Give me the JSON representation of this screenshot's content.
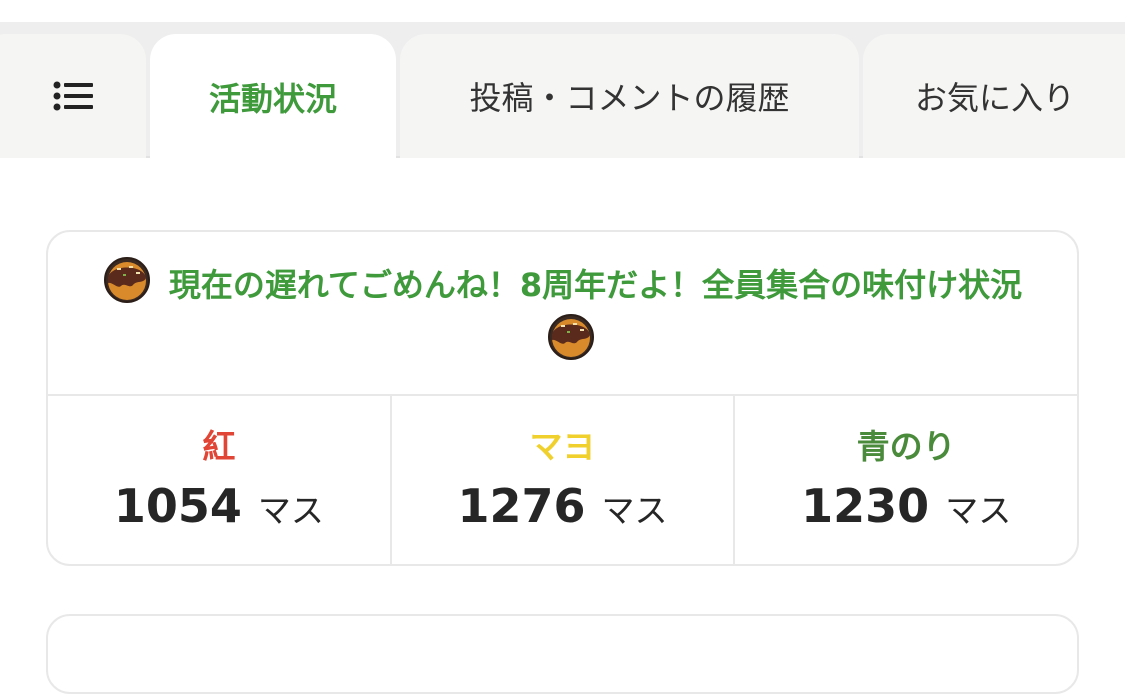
{
  "tabs": {
    "menu_icon": "list-icon",
    "activity": "活動状況",
    "posts": "投稿・コメントの履歴",
    "favorites": "お気に入り",
    "active_color": "#3f9a3c"
  },
  "event_card": {
    "title": "現在の遅れてごめんね！8周年だよ！全員集合の味付け状況",
    "decoration_icon": "takoyaki-icon",
    "teams": [
      {
        "name": "紅",
        "score": "1054",
        "unit": "マス",
        "color": "#e04535"
      },
      {
        "name": "マヨ",
        "score": "1276",
        "unit": "マス",
        "color": "#f0d02c"
      },
      {
        "name": "青のり",
        "score": "1230",
        "unit": "マス",
        "color": "#4a8a3b"
      }
    ]
  }
}
